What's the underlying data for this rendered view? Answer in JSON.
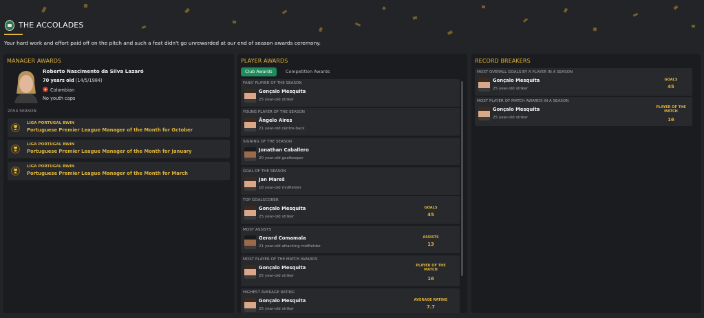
{
  "header": {
    "title": "THE ACCOLADES",
    "intro": "Your hard work and effort paid off on the pitch and such a feat didn't go unrewarded at our end of season awards ceremony."
  },
  "manager_awards": {
    "title": "MANAGER AWARDS",
    "name": "Roberto Nascimento da Silva Lazaró",
    "age": "70 years old",
    "dob": "(14/5/1984)",
    "nationality": "Colombian",
    "caps": "No youth caps",
    "season": "2054 SEASON",
    "awards": [
      {
        "competition": "LIGA PORTUGAL BWIN",
        "title": "Portuguese Premier League Manager of the Month for October"
      },
      {
        "competition": "LIGA PORTUGAL BWIN",
        "title": "Portuguese Premier League Manager of the Month for January"
      },
      {
        "competition": "LIGA PORTUGAL BWIN",
        "title": "Portuguese Premier League Manager of the Month for March"
      }
    ]
  },
  "player_awards": {
    "title": "PLAYER AWARDS",
    "tabs": [
      "Club Awards",
      "Competition Awards"
    ],
    "items": [
      {
        "label": "FANS' PLAYER OF THE SEASON",
        "name": "Gonçalo Mesquita",
        "desc": "25 year-old striker",
        "stat_label": "",
        "stat_value": ""
      },
      {
        "label": "YOUNG PLAYER OF THE SEASON",
        "name": "Ângelo Aires",
        "desc": "21 year-old centre-back",
        "stat_label": "",
        "stat_value": ""
      },
      {
        "label": "SIGNING OF THE SEASON",
        "name": "Jonathan Caballero",
        "desc": "20 year-old goalkeeper",
        "stat_label": "",
        "stat_value": ""
      },
      {
        "label": "GOAL OF THE SEASON",
        "name": "Jan Mareš",
        "desc": "18 year-old midfielder",
        "stat_label": "",
        "stat_value": ""
      },
      {
        "label": "TOP GOALSCORER",
        "name": "Gonçalo Mesquita",
        "desc": "25 year-old striker",
        "stat_label": "GOALS",
        "stat_value": "45"
      },
      {
        "label": "MOST ASSISTS",
        "name": "Gerard Comamala",
        "desc": "21 year-old attacking midfielder",
        "stat_label": "ASSISTS",
        "stat_value": "13"
      },
      {
        "label": "MOST PLAYER OF THE MATCH AWARDS",
        "name": "Gonçalo Mesquita",
        "desc": "25 year-old striker",
        "stat_label": "PLAYER OF THE MATCH",
        "stat_value": "16"
      },
      {
        "label": "HIGHEST AVERAGE RATING",
        "name": "Gonçalo Mesquita",
        "desc": "25 year-old striker",
        "stat_label": "AVERAGE RATING",
        "stat_value": "7.7"
      }
    ]
  },
  "record_breakers": {
    "title": "RECORD BREAKERS",
    "items": [
      {
        "label": "MOST OVERALL GOALS BY A PLAYER IN A SEASON",
        "name": "Gonçalo Mesquita",
        "desc": "25 year-old striker",
        "stat_label": "GOALS",
        "stat_value": "45"
      },
      {
        "label": "MOST PLAYER OF MATCH AWARDS IN A SEASON",
        "name": "Gonçalo Mesquita",
        "desc": "25 year-old striker",
        "stat_label": "PLAYER OF THE MATCH",
        "stat_value": "16"
      }
    ]
  },
  "colors": {
    "accent": "#e2b53c",
    "tab_active": "#1f8c5c",
    "panel": "#1b1c1f",
    "card": "#27292d"
  }
}
